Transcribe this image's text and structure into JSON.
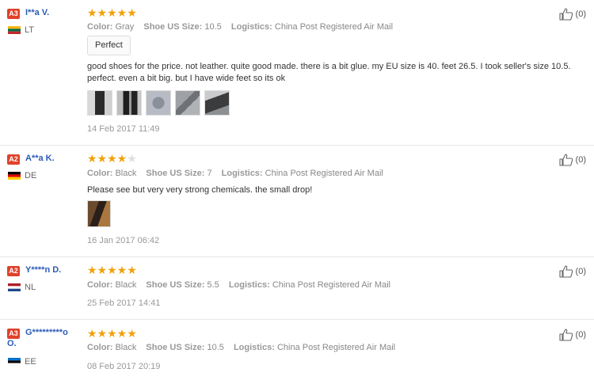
{
  "reviews": [
    {
      "badge": "A3",
      "name": "I**a V.",
      "country": "LT",
      "rating": 5,
      "color_label": "Color:",
      "color": "Gray",
      "size_label": "Shoe US Size:",
      "size": "10.5",
      "logistics_label": "Logistics:",
      "logistics": "China Post Registered Air Mail",
      "tag": "Perfect",
      "text": "good shoes for the price. not leather. quite good made. there is a bit glue. my EU size is 40. feet 26.5. I took seller's size 10.5. perfect. even a bit big. but I have wide feet so its ok",
      "date": "14 Feb 2017 11:49",
      "likes": "(0)"
    },
    {
      "badge": "A2",
      "name": "A**a K.",
      "country": "DE",
      "rating": 4,
      "color_label": "Color:",
      "color": "Black",
      "size_label": "Shoe US Size:",
      "size": "7",
      "logistics_label": "Logistics:",
      "logistics": "China Post Registered Air Mail",
      "text": "Please see but very very strong chemicals. the small drop!",
      "date": "16 Jan 2017 06:42",
      "likes": "(0)"
    },
    {
      "badge": "A2",
      "name": "Y****n D.",
      "country": "NL",
      "rating": 5,
      "color_label": "Color:",
      "color": "Black",
      "size_label": "Shoe US Size:",
      "size": "5.5",
      "logistics_label": "Logistics:",
      "logistics": "China Post Registered Air Mail",
      "date": "25 Feb 2017 14:41",
      "likes": "(0)"
    },
    {
      "badge": "A3",
      "name": "G*********o O.",
      "country": "EE",
      "rating": 5,
      "color_label": "Color:",
      "color": "Black",
      "size_label": "Shoe US Size:",
      "size": "10.5",
      "logistics_label": "Logistics:",
      "logistics": "China Post Registered Air Mail",
      "date": "08 Feb 2017 20:19",
      "likes": "(0)"
    }
  ],
  "colors": {
    "badge": "#e0412a",
    "name": "#2b5bb7",
    "star": "#f2a10a"
  }
}
